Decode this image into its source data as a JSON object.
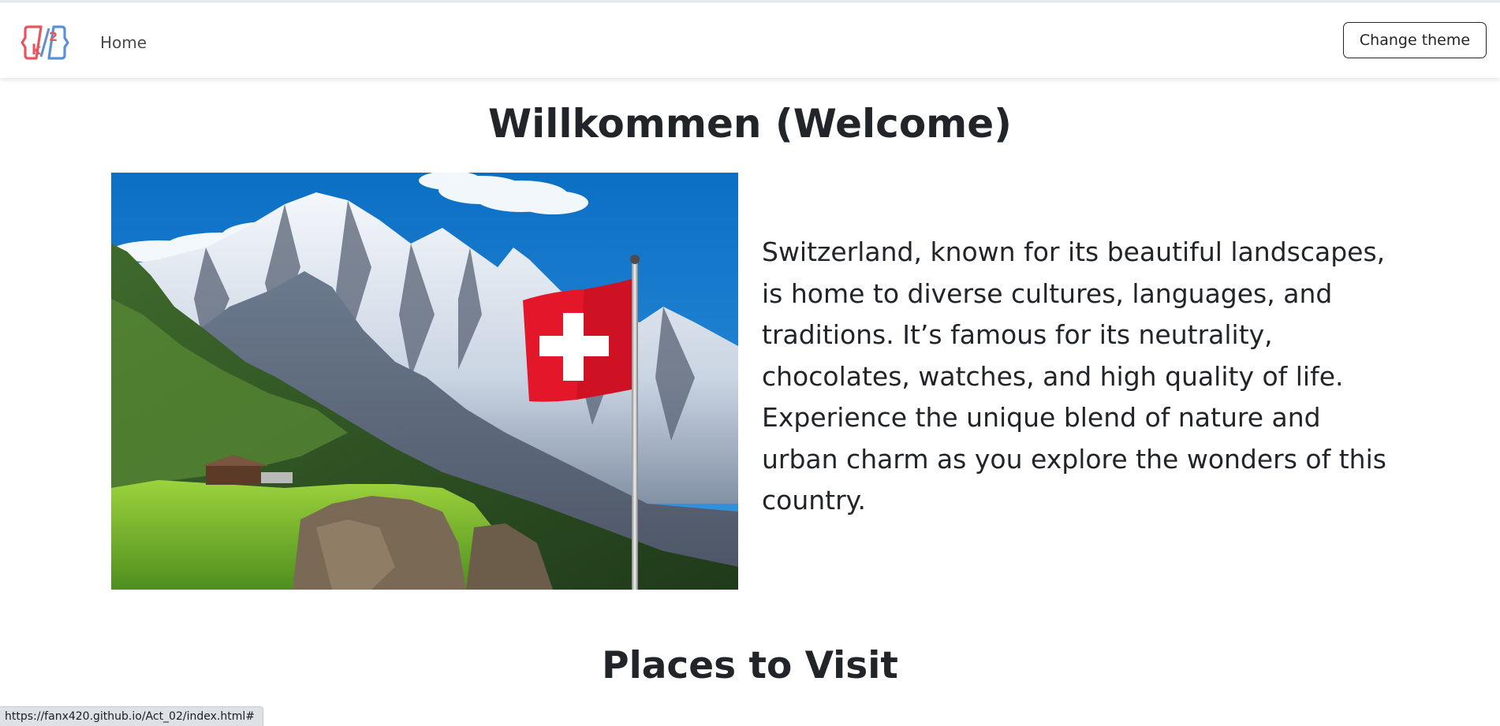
{
  "navbar": {
    "logo_icon": "k2-logo-icon",
    "home_label": "Home",
    "theme_button_label": "Change theme"
  },
  "main": {
    "welcome_title": "Willkommen (Welcome)",
    "hero_image": {
      "subject": "swiss-alps-with-flag",
      "icon": "swiss-flag-icon"
    },
    "intro_text": "Switzerland, known for its beautiful landscapes, is home to diverse cultures, languages, and traditions. It’s famous for its neutrality, chocolates, watches, and high quality of life. Experience the unique blend of nature and urban charm as you explore the wonders of this country.",
    "places_title": "Places to Visit"
  },
  "statusbar": {
    "url": "https://fanx420.github.io/Act_02/index.html#"
  },
  "colors": {
    "text": "#212529",
    "flag_red": "#e4172a",
    "sky_blue": "#0a72c8",
    "logo_red": "#e8555f",
    "logo_blue": "#5b8fd6"
  }
}
